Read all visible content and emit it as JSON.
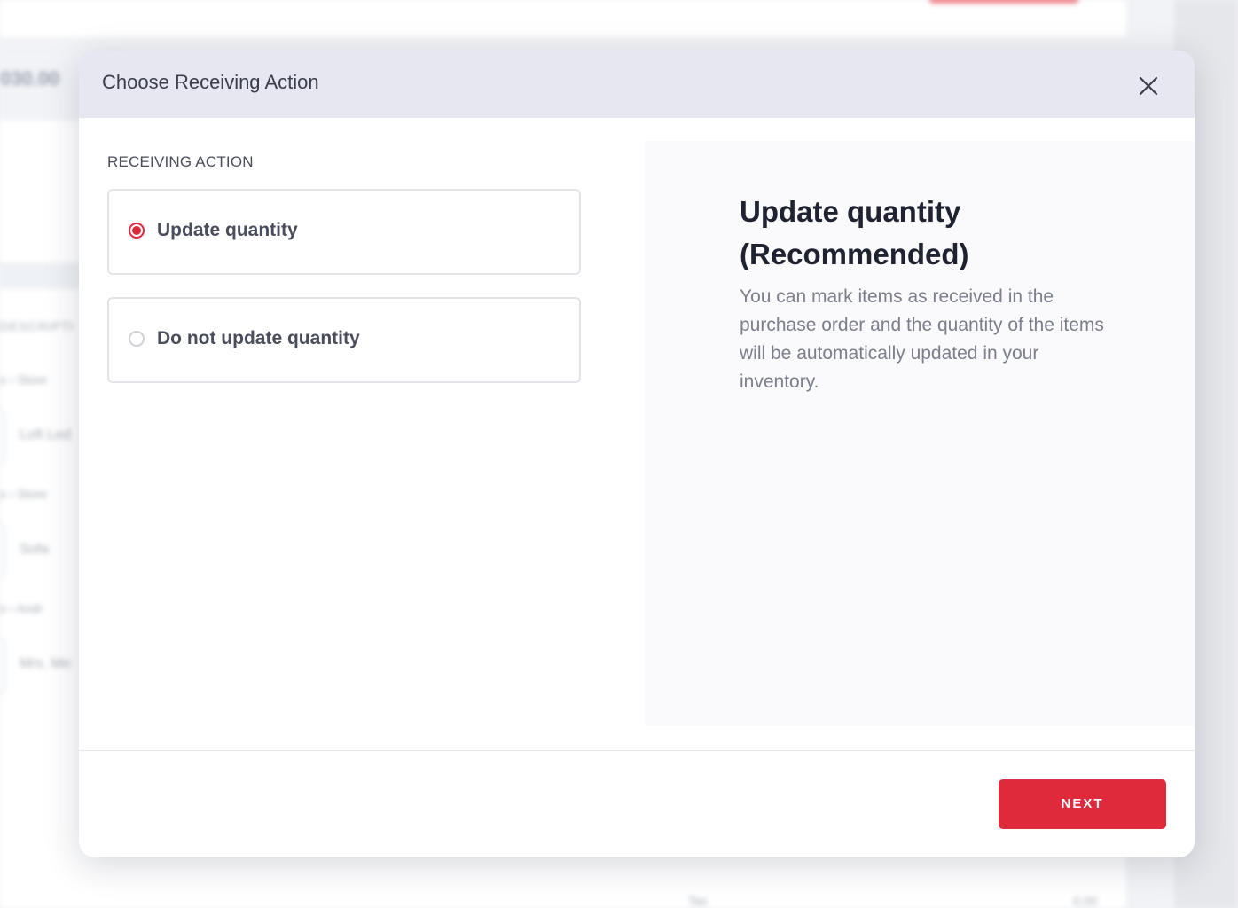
{
  "background": {
    "total_amount": "030.00",
    "table_header": "DESCRIPTI",
    "rows": [
      {
        "breadcrumb": "s  ›  Store",
        "name": "Loft Led"
      },
      {
        "breadcrumb": "s  ›  Store",
        "name": "Sofa"
      },
      {
        "breadcrumb": "s  ›  Andr",
        "name": "Mrs. Me"
      }
    ],
    "footer_label": "Tax",
    "footer_value": "0.00"
  },
  "modal": {
    "title": "Choose Receiving Action",
    "close_icon": "close-icon",
    "section_label": "RECEIVING ACTION",
    "options": [
      {
        "label": "Update quantity",
        "selected": true
      },
      {
        "label": "Do not update quantity",
        "selected": false
      }
    ],
    "info": {
      "title": "Update quantity (Recommended)",
      "description": "You can mark items as received in the purchase order and the quantity of the items will be automatically updated in your inventory."
    },
    "next_label": "NEXT"
  },
  "colors": {
    "accent": "#df2a3b",
    "header_bg": "#e6e7f0",
    "info_bg": "#fafafd"
  }
}
